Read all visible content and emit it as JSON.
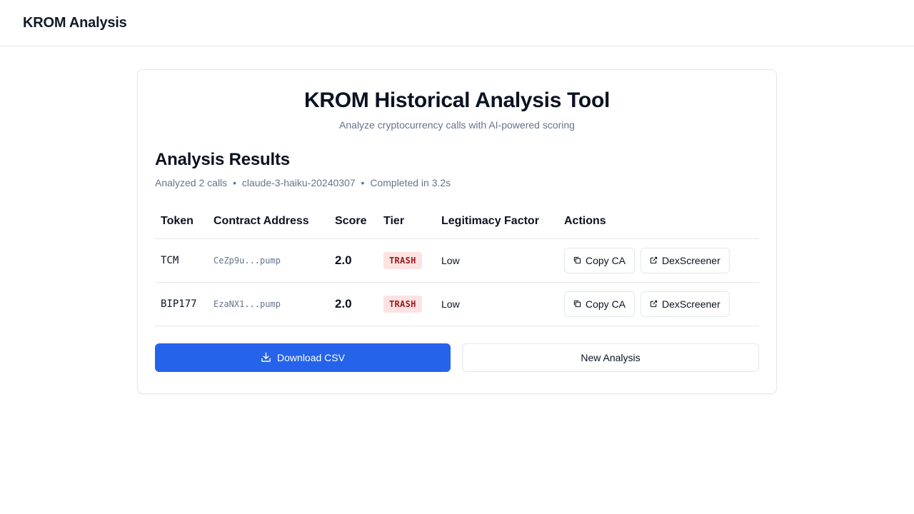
{
  "header": {
    "title": "KROM Analysis"
  },
  "hero": {
    "title": "KROM Historical Analysis Tool",
    "subtitle": "Analyze cryptocurrency calls with AI-powered scoring"
  },
  "results": {
    "title": "Analysis Results",
    "meta": {
      "calls": "Analyzed 2 calls",
      "model": "claude-3-haiku-20240307",
      "duration": "Completed in 3.2s",
      "separator": "•"
    },
    "columns": [
      "Token",
      "Contract Address",
      "Score",
      "Tier",
      "Legitimacy Factor",
      "Actions"
    ],
    "rows": [
      {
        "token": "TCM",
        "contract": "CeZp9u...pump",
        "score": "2.0",
        "tier": "TRASH",
        "legitimacy": "Low",
        "copy_label": "Copy CA",
        "dex_label": "DexScreener"
      },
      {
        "token": "BIP177",
        "contract": "EzaNX1...pump",
        "score": "2.0",
        "tier": "TRASH",
        "legitimacy": "Low",
        "copy_label": "Copy CA",
        "dex_label": "DexScreener"
      }
    ]
  },
  "footer": {
    "download_label": "Download CSV",
    "new_label": "New Analysis"
  },
  "colors": {
    "primary": "#2563eb",
    "tier_trash_bg": "#fde2e2",
    "tier_trash_text": "#991b1b",
    "muted_text": "#64748b"
  },
  "icons": {
    "copy": "copy-icon",
    "external": "external-link-icon",
    "download": "download-icon"
  }
}
